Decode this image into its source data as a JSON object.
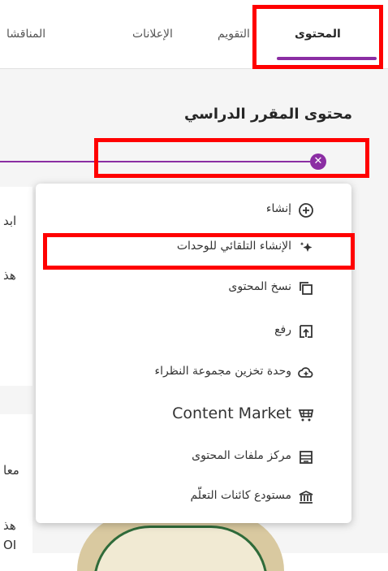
{
  "tabs": [
    {
      "label": "المحتوى",
      "active": true
    },
    {
      "label": "التقويم",
      "active": false
    },
    {
      "label": "الإعلانات",
      "active": false
    },
    {
      "label": "المناقشا",
      "active": false
    }
  ],
  "heading": "محتوى المقرر الدراسي",
  "background_fragments": {
    "line1": "ابد",
    "line2": "هذ",
    "line3": "معا",
    "line4": "هذ",
    "line5": "OI"
  },
  "menu": {
    "items": [
      {
        "label": "إنشاء",
        "icon": "plus-circle-icon"
      },
      {
        "label": "الإنشاء التلقائي للوحدات",
        "icon": "sparkle-icon"
      },
      {
        "label": "نسخ المحتوى",
        "icon": "copy-icon"
      },
      {
        "label": "رفع",
        "icon": "upload-icon"
      },
      {
        "label": "وحدة تخزين مجموعة النظراء",
        "icon": "cloud-add-icon"
      },
      {
        "label": "Content Market",
        "icon": "cart-icon"
      },
      {
        "label": "مركز ملفات المحتوى",
        "icon": "archive-icon"
      },
      {
        "label": "مستودع كائنات التعلّم",
        "icon": "bank-icon"
      }
    ]
  },
  "colors": {
    "accent": "#8b2ea3",
    "highlight": "#ff0000"
  }
}
